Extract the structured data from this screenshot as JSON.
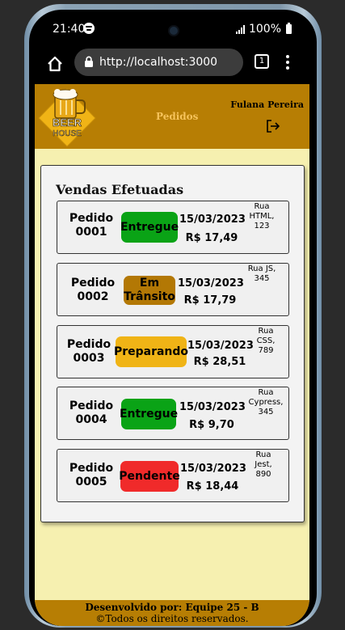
{
  "status_bar": {
    "time": "21:40",
    "battery": "100%"
  },
  "browser": {
    "url": "http://localhost:3000",
    "tab_count": "1"
  },
  "header": {
    "logo_text": "BEER HOUSE",
    "nav_label": "Pedidos",
    "user_name": "Fulana Pereira"
  },
  "main": {
    "title": "Vendas Efetuadas",
    "orders": [
      {
        "id_line1": "Pedido",
        "id_line2": "0001",
        "status": "Entregue",
        "date": "15/03/2023",
        "price": "R$ 17,49",
        "address": "Rua HTML, 123",
        "status_color": "#0aa316"
      },
      {
        "id_line1": "Pedido",
        "id_line2": "0002",
        "status": "Em Trânsito",
        "date": "15/03/2023",
        "price": "R$ 17,79",
        "address": "Rua JS, 345",
        "status_color": "#b37805"
      },
      {
        "id_line1": "Pedido",
        "id_line2": "0003",
        "status": "Preparando",
        "date": "15/03/2023",
        "price": "R$ 28,51",
        "address": "Rua CSS, 789",
        "status_color": "#f0b416"
      },
      {
        "id_line1": "Pedido",
        "id_line2": "0004",
        "status": "Entregue",
        "date": "15/03/2023",
        "price": "R$ 9,70",
        "address": "Rua Cypress, 345",
        "status_color": "#0aa316"
      },
      {
        "id_line1": "Pedido",
        "id_line2": "0005",
        "status": "Pendente",
        "date": "15/03/2023",
        "price": "R$ 18,44",
        "address": "Rua Jest, 890",
        "status_color": "#f02a2a"
      }
    ]
  },
  "footer": {
    "line1": "Desenvolvido por: Equipe 25 - B",
    "line2": "©Todos os direitos reservados."
  },
  "colors": {
    "brand": "#b77e04",
    "background": "#f6f0b0",
    "nav": "#f6c35b"
  }
}
